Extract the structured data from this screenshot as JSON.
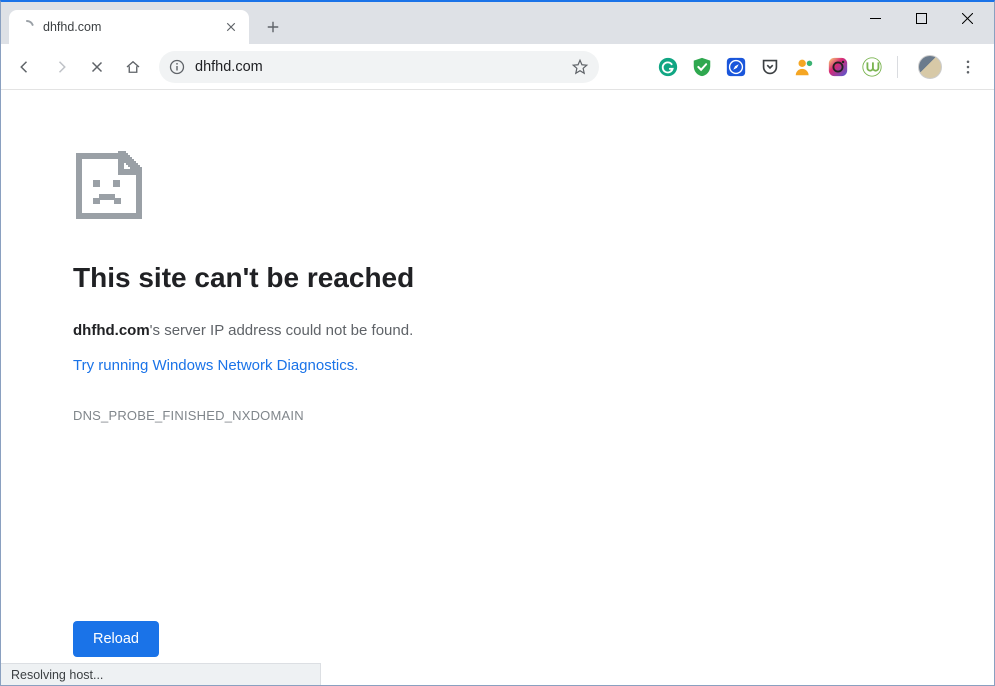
{
  "window": {
    "minimize_name": "minimize",
    "maximize_name": "maximize",
    "close_name": "close"
  },
  "tab": {
    "title": "dhfhd.com",
    "loading": true
  },
  "toolbar": {
    "url": "dhfhd.com",
    "back_enabled": true,
    "forward_enabled": false,
    "extensions": [
      {
        "name": "grammarly-icon"
      },
      {
        "name": "adguard-icon"
      },
      {
        "name": "safari-ext-icon"
      },
      {
        "name": "pocket-icon"
      },
      {
        "name": "person-ext-icon"
      },
      {
        "name": "instagram-ext-icon"
      },
      {
        "name": "utorrent-ext-icon"
      }
    ]
  },
  "error": {
    "heading": "This site can't be reached",
    "domain": "dhfhd.com",
    "message_suffix": "'s server IP address could not be found.",
    "diagnostics_link": "Try running Windows Network Diagnostics",
    "diagnostics_period": ".",
    "code": "DNS_PROBE_FINISHED_NXDOMAIN",
    "reload_label": "Reload"
  },
  "status": {
    "text": "Resolving host..."
  },
  "colors": {
    "accent": "#1a73e8",
    "text": "#202124",
    "muted": "#5f6368"
  }
}
